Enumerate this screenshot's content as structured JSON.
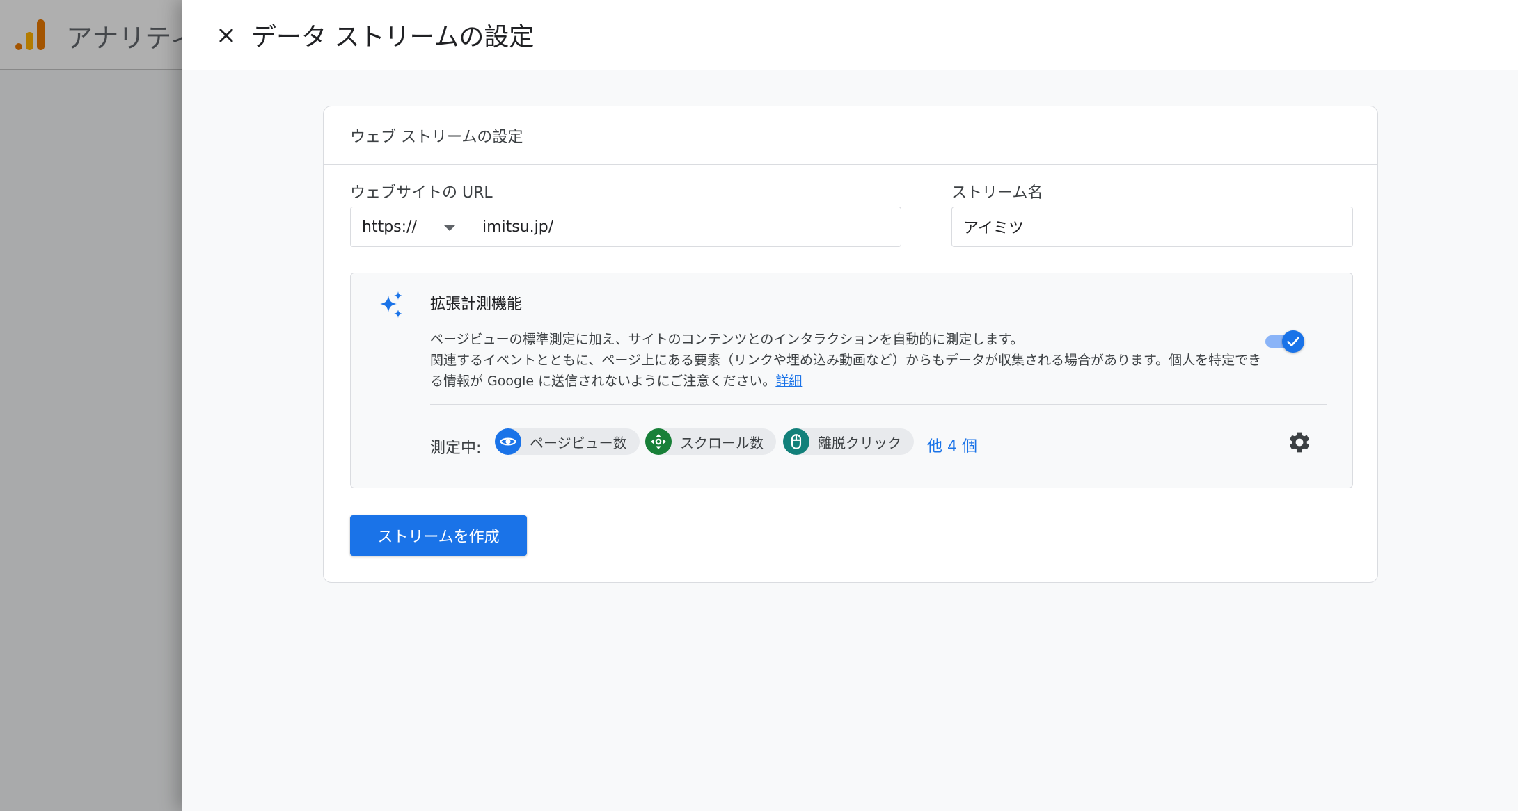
{
  "background_app": {
    "title": "アナリティクス"
  },
  "drawer": {
    "title": "データ ストリームの設定"
  },
  "card": {
    "title": "ウェブ ストリームの設定",
    "url_field": {
      "label": "ウェブサイトの URL",
      "protocol": "https://",
      "value": "imitsu.jp/"
    },
    "stream_name_field": {
      "label": "ストリーム名",
      "value": "アイミツ"
    },
    "enhanced_measurement": {
      "title": "拡張計測機能",
      "description_line1": "ページビューの標準測定に加え、サイトのコンテンツとのインタラクションを自動的に測定します。",
      "description_line2": "関連するイベントとともに、ページ上にある要素（リンクや埋め込み動画など）からもデータが収集される場合があります。個人を特定できる情報が Google に送信されないようにご注意ください。",
      "learn_more_link": "詳細",
      "enabled": true,
      "measuring_label": "測定中:",
      "chips": [
        {
          "label": "ページビュー数",
          "icon": "eye-icon",
          "color": "#1a73e8"
        },
        {
          "label": "スクロール数",
          "icon": "scroll-arrows-icon",
          "color": "#188038"
        },
        {
          "label": "離脱クリック",
          "icon": "mouse-icon",
          "color": "#12807a"
        }
      ],
      "more_link": "他 4 個"
    },
    "create_button": "ストリームを作成"
  },
  "colors": {
    "primary": "#1a73e8",
    "toggle_track": "#8ab4f8"
  }
}
